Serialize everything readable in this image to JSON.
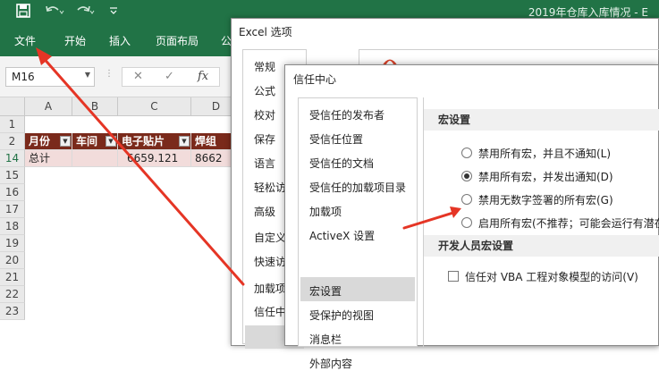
{
  "title_bar": {
    "title": "2019年仓库入库情况 - E",
    "save_icon": "save-icon",
    "undo_icon": "undo-icon",
    "redo_icon": "redo-icon",
    "customize_icon": "customize-qat-icon"
  },
  "ribbon": {
    "tabs": [
      "文件",
      "开始",
      "插入",
      "页面布局",
      "公"
    ]
  },
  "formula_bar": {
    "name_box": "M16",
    "cancel_glyph": "✕",
    "enter_glyph": "✓",
    "fx_label": "fx"
  },
  "sheet": {
    "columns": [
      "A",
      "B",
      "C",
      "D"
    ],
    "rows": [
      "1",
      "2",
      "14",
      "15",
      "16",
      "17",
      "18",
      "19",
      "20",
      "21",
      "22",
      "23"
    ],
    "header_row": [
      "月份",
      "车间",
      "电子贴片",
      "焊组"
    ],
    "total_row": [
      "总计",
      "",
      "6659.121",
      "8662"
    ],
    "accent": "#7a2a1b"
  },
  "excel_options": {
    "title": "Excel 选项",
    "nav": [
      "常规",
      "公式",
      "校对",
      "保存",
      "语言",
      "轻松访",
      "高级",
      "自定义",
      "快速访",
      "加载项",
      "信任中"
    ]
  },
  "trust_center": {
    "title": "信任中心",
    "nav": [
      "受信任的发布者",
      "受信任位置",
      "受信任的文档",
      "受信任的加载项目录",
      "加载项",
      "ActiveX 设置",
      "宏设置",
      "受保护的视图",
      "消息栏",
      "外部内容"
    ],
    "selected": "宏设置",
    "macro_section": "宏设置",
    "macro_options": [
      {
        "label": "禁用所有宏，并且不通知(L)",
        "checked": false
      },
      {
        "label": "禁用所有宏，并发出通知(D)",
        "checked": true
      },
      {
        "label": "禁用无数字签署的所有宏(G)",
        "checked": false
      },
      {
        "label": "启用所有宏(不推荐；可能会运行有潜在",
        "checked": false
      }
    ],
    "developer_section": "开发人员宏设置",
    "vba_trust_label": "信任对 VBA 工程对象模型的访问(V)",
    "vba_trust_checked": false
  },
  "annotation_color": "#e53525"
}
